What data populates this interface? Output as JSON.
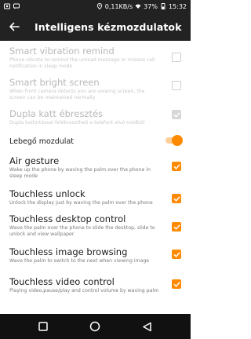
{
  "status_bar": {
    "network_speed": "0,11KB/s",
    "battery": "37%",
    "time": "15:32"
  },
  "header": {
    "title": "Intelligens kézmozdulatok"
  },
  "items": [
    {
      "title": "Smart vibration remind",
      "subtitle": "Phone vibrate to remind the unread message or missed call notification in sleep mode",
      "enabled": false,
      "checked": false
    },
    {
      "title": "Smart bright screen",
      "subtitle": "When front camera detects you are viewing screen, the screen can be maintained normally",
      "enabled": false,
      "checked": false
    },
    {
      "title": "Dupla katt ébresztés",
      "subtitle": "Dupla kattintással felébresztheti a telefont alvó módból",
      "enabled": false,
      "checked": true
    },
    {
      "title": "Lebegő mozdulat",
      "toggle_on": true
    },
    {
      "title": "Air gesture",
      "subtitle": "Wake up the phone by waving the palm over the phone in sleep mode",
      "enabled": true,
      "checked": true
    },
    {
      "title": "Touchless unlock",
      "subtitle": "Unlock the display just by waving the palm over the phone",
      "enabled": true,
      "checked": true
    },
    {
      "title": "Touchless desktop control",
      "subtitle": "Wave the palm over the phone to slide the desktop, slide to unlock and view wallpaper",
      "enabled": true,
      "checked": true
    },
    {
      "title": "Touchless image browsing",
      "subtitle": "Wave the palm to switch to the next when viewing image",
      "enabled": true,
      "checked": true
    },
    {
      "title": "Touchless video control",
      "subtitle": "Playing video,pause/play and control volume by waving palm",
      "enabled": true,
      "checked": true
    }
  ],
  "colors": {
    "accent": "#ff8a00",
    "bar": "#222222"
  }
}
